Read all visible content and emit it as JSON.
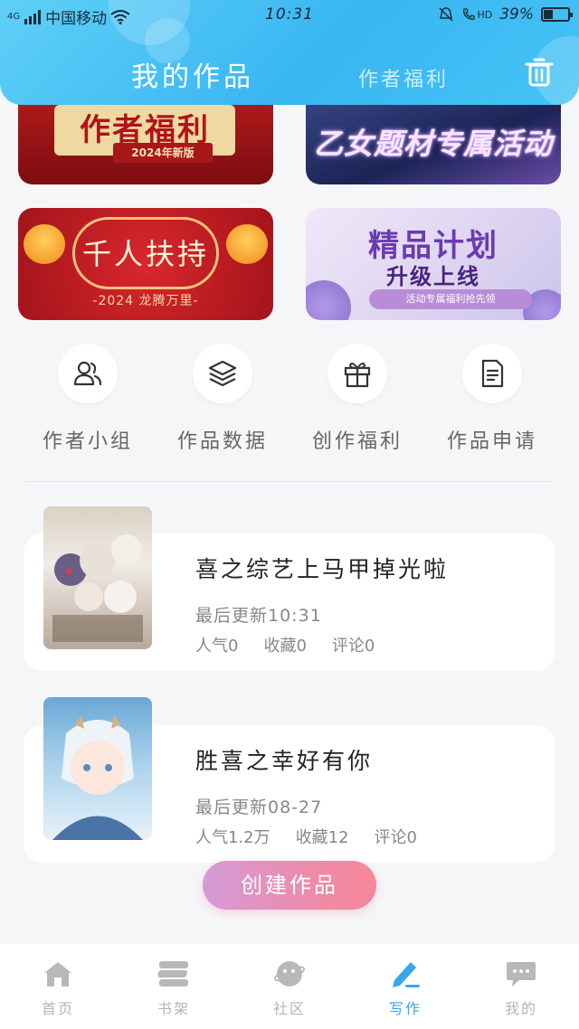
{
  "status_bar": {
    "network": "4G",
    "carrier": "中国移动",
    "time": "10:31",
    "hd": "HD",
    "battery_percent": "39%",
    "battery_level": 0.39
  },
  "header": {
    "tab_active": "我的作品",
    "tab_other": "作者福利",
    "trash_icon": "trash-icon"
  },
  "banners": [
    {
      "title": "作者福利",
      "subtitle": "2024年新版"
    },
    {
      "title": "乙女题材专属活动"
    },
    {
      "title": "千人扶持",
      "subtitle": "-2024 龙腾万里-"
    },
    {
      "title": "精品计划",
      "title2": "升级上线",
      "subtitle": "活动专属福利抢先领"
    }
  ],
  "quick_actions": [
    {
      "label": "作者小组",
      "icon": "users-icon"
    },
    {
      "label": "作品数据",
      "icon": "layers-icon"
    },
    {
      "label": "创作福利",
      "icon": "gift-icon"
    },
    {
      "label": "作品申请",
      "icon": "document-icon"
    }
  ],
  "works": [
    {
      "title": "喜之综艺上马甲掉光啦",
      "updated": "最后更新10:31",
      "popularity": "人气0",
      "favorites": "收藏0",
      "comments": "评论0"
    },
    {
      "title": "胜喜之幸好有你",
      "updated": "最后更新08-27",
      "popularity": "人气1.2万",
      "favorites": "收藏12",
      "comments": "评论0"
    }
  ],
  "create_button": "创建作品",
  "nav": [
    {
      "label": "首页",
      "icon": "home-icon"
    },
    {
      "label": "书架",
      "icon": "bookshelf-icon"
    },
    {
      "label": "社区",
      "icon": "community-icon"
    },
    {
      "label": "写作",
      "icon": "write-icon",
      "active": true
    },
    {
      "label": "我的",
      "icon": "profile-icon"
    }
  ],
  "colors": {
    "accent": "#3aa6ee",
    "header": "#39b6f2",
    "create_button": "#ef8aa3"
  }
}
